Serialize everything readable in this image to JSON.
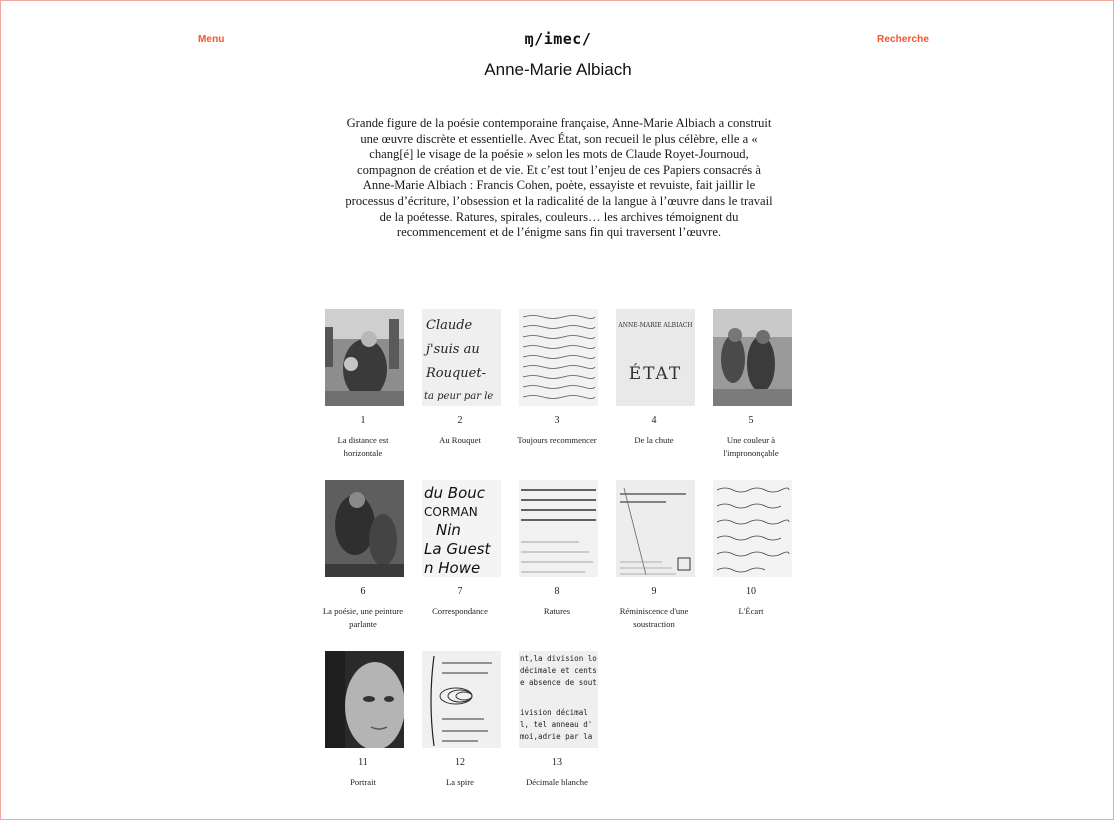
{
  "header": {
    "menu_label": "Menu",
    "logo_text": "ɱ/imec/",
    "search_label": "Recherche"
  },
  "page": {
    "title": "Anne-Marie Albiach",
    "intro": "Grande figure de la poésie contemporaine française, Anne-Marie Albiach a construit une œuvre discrète et essentielle. Avec État, son recueil le plus célèbre, elle a « chang[é] le visage de la poésie » selon les mots de Claude Royet-Journoud, compagnon de création et de vie. Et c’est tout l’enjeu de ces Papiers consacrés à Anne-Marie Albiach : Francis Cohen, poète, essayiste et revuiste, fait jaillir le processus d’écriture, l’obsession et la radicalité de la langue à l’œuvre dans le travail de la poétesse. Ratures, spirales, couleurs… les archives témoignent du recommencement et de l’énigme sans fin qui traversent l’œuvre."
  },
  "accent_color": "#f2542d",
  "items": [
    {
      "num": "1",
      "label": "La distance est horizontale",
      "image": "photo-couple-in-park",
      "thumb_text": ""
    },
    {
      "num": "2",
      "label": "Au Rouquet",
      "image": "handwritten-note",
      "thumb_text": "Claude\nj'suis au\nRouquet-\nta peur par le"
    },
    {
      "num": "3",
      "label": "Toujours recommencer",
      "image": "handwritten-manuscript",
      "thumb_text": ""
    },
    {
      "num": "4",
      "label": "De la chute",
      "image": "book-cover-etat",
      "thumb_text": "ANNE-MARIE ALBIACH\nÉTAT"
    },
    {
      "num": "5",
      "label": "Une couleur à l'imprononçable",
      "image": "painting-figures",
      "thumb_text": ""
    },
    {
      "num": "6",
      "label": "La poésie, une peinture parlante",
      "image": "painting-dark",
      "thumb_text": ""
    },
    {
      "num": "7",
      "label": "Correspondance",
      "image": "handwritten-names",
      "thumb_text": "du Bouc\nCORMAN\nNin\nLa Guest\nn Howe"
    },
    {
      "num": "8",
      "label": "Ratures",
      "image": "typed-crossed-out",
      "thumb_text": ""
    },
    {
      "num": "9",
      "label": "Réminiscence d'une soustraction",
      "image": "typed-page-annotated",
      "thumb_text": ""
    },
    {
      "num": "10",
      "label": "L'Écart",
      "image": "handwritten-lines",
      "thumb_text": ""
    },
    {
      "num": "11",
      "label": "Portrait",
      "image": "portrait-close-up",
      "thumb_text": ""
    },
    {
      "num": "12",
      "label": "La spire",
      "image": "spiral-manuscript",
      "thumb_text": ""
    },
    {
      "num": "13",
      "label": "Décimale blanche",
      "image": "typewritten-text",
      "thumb_text": "nt,la division lo\n décimale et cents\ne absence de sout\nivision décimal\nl, tel anneau d'\nmoi,adrie par la"
    }
  ]
}
